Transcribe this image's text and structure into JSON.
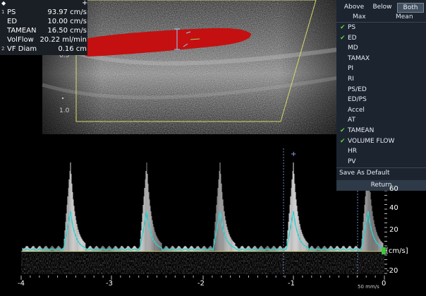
{
  "measurements": {
    "header_left": "◆",
    "header_right": "+",
    "rows": [
      {
        "index": "1",
        "label": "PS",
        "value": "93.97 cm/s"
      },
      {
        "index": "",
        "label": "ED",
        "value": "10.00 cm/s"
      },
      {
        "index": "",
        "label": "TAMEAN",
        "value": "16.50 cm/s"
      },
      {
        "index": "",
        "label": "VolFlow",
        "value": "20.22 ml/min"
      },
      {
        "index": "2",
        "label": "VF Diam",
        "value": "0.16 cm"
      }
    ]
  },
  "depth_scale": {
    "mark_top": "0.5",
    "mark_bottom": "1.0"
  },
  "calc_menu": {
    "tabs": {
      "above": "Above",
      "below": "Below",
      "both": "Both"
    },
    "selected_tab": "Both",
    "sub": {
      "max": "Max",
      "mean": "Mean"
    },
    "check_glyph": "✔",
    "items": [
      {
        "label": "PS",
        "checked": true
      },
      {
        "label": "ED",
        "checked": true
      },
      {
        "label": "MD",
        "checked": false
      },
      {
        "label": "TAMAX",
        "checked": false
      },
      {
        "label": "PI",
        "checked": false
      },
      {
        "label": "RI",
        "checked": false
      },
      {
        "label": "PS/ED",
        "checked": false
      },
      {
        "label": "ED/PS",
        "checked": false
      },
      {
        "label": "Accel",
        "checked": false
      },
      {
        "label": "AT",
        "checked": false
      },
      {
        "label": "TAMEAN",
        "checked": true
      },
      {
        "label": "VOLUME FLOW",
        "checked": true
      },
      {
        "label": "HR",
        "checked": false
      },
      {
        "label": "PV",
        "checked": false
      }
    ],
    "save_default": "Save As Default",
    "return": "Return"
  },
  "doppler": {
    "velocity_ticks": [
      "40",
      "20",
      "-20"
    ],
    "partial_tick": "60",
    "unit": "[cm/s]",
    "time_ticks": [
      "-4",
      "-3",
      "-2",
      "-1",
      "0"
    ],
    "sweep": "50 mm/s",
    "trace_color": "#2fd0d0",
    "flow_color": "#c41010"
  }
}
